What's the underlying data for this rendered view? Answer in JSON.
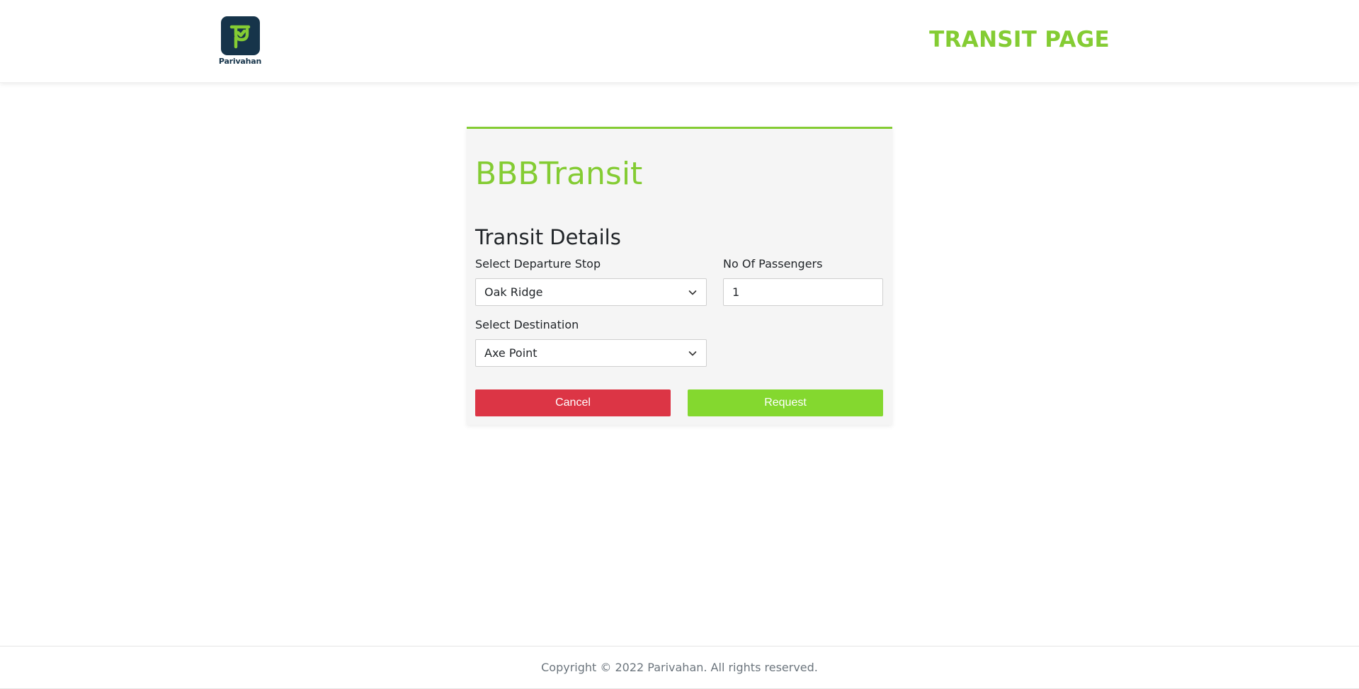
{
  "header": {
    "logo_text": "Parivahan",
    "title": "TRANSIT PAGE"
  },
  "card": {
    "brand": "BBBTransit",
    "section_title": "Transit Details",
    "departure": {
      "label": "Select Departure Stop",
      "value": "Oak Ridge"
    },
    "passengers": {
      "label": "No Of Passengers",
      "value": "1"
    },
    "destination": {
      "label": "Select Destination",
      "value": "Axe Point"
    },
    "cancel_label": "Cancel",
    "request_label": "Request"
  },
  "footer": {
    "copyright": "Copyright © 2022 Parivahan. All rights reserved."
  },
  "colors": {
    "accent": "#84cc33",
    "logo_bg": "#16344a",
    "cancel": "#dc3545",
    "request": "#84d82f"
  },
  "icons": [
    "parivahan-logo-icon",
    "chevron-down-icon"
  ]
}
